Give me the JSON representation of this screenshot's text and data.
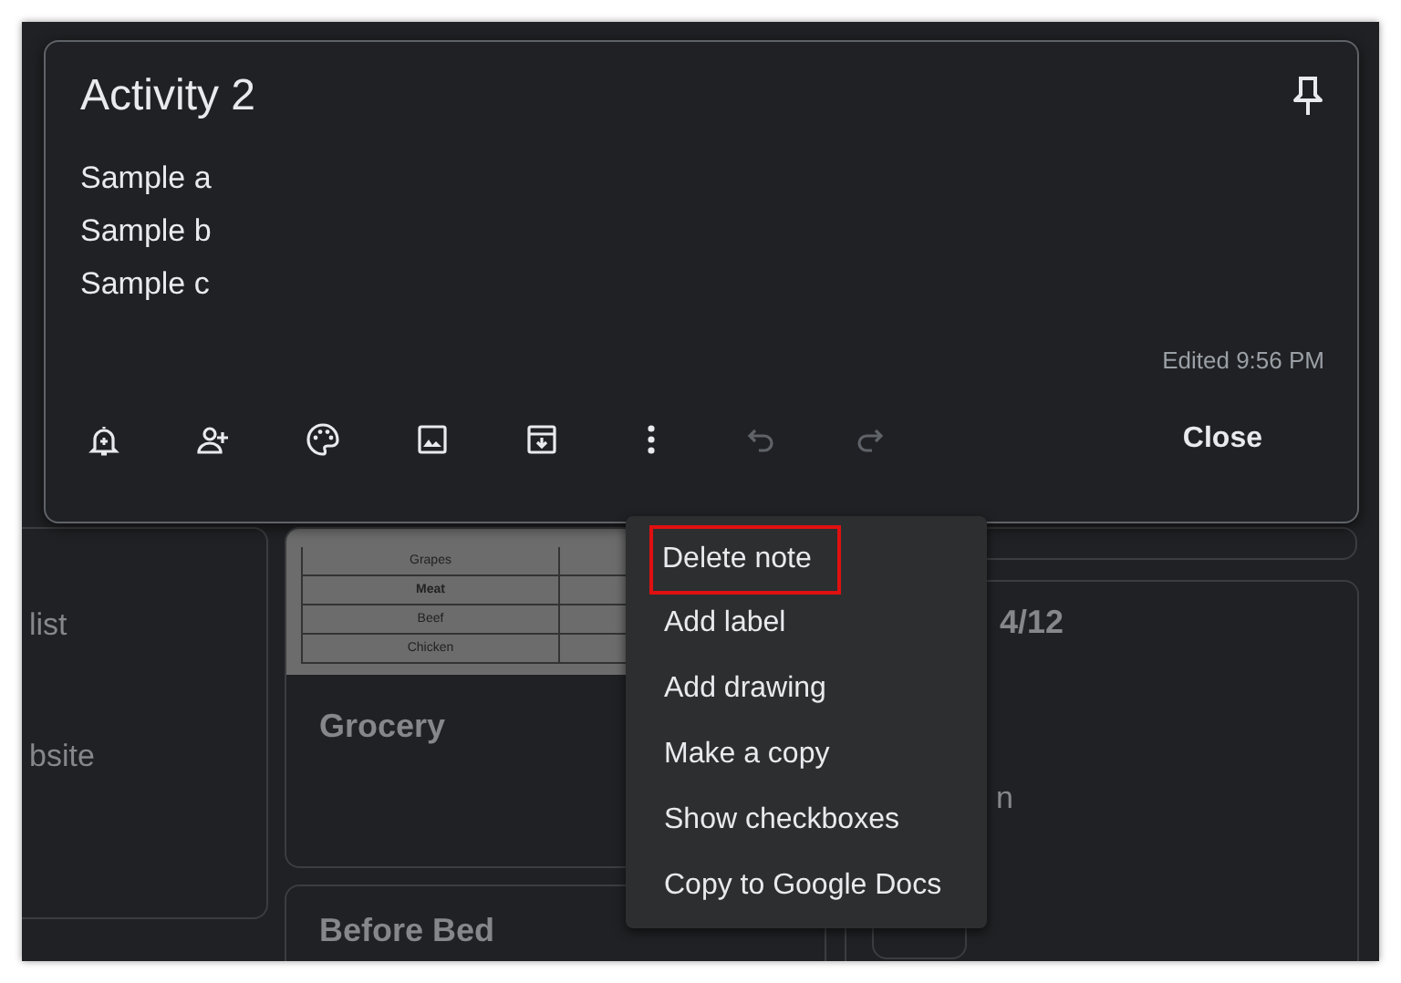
{
  "background": {
    "notes": [
      {
        "kind": "left",
        "texts": [
          "list",
          "bsite"
        ]
      },
      {
        "kind": "table",
        "table": [
          {
            "label": "Grapes",
            "bold": false
          },
          {
            "label": "Meat",
            "bold": true
          },
          {
            "label": "Beef",
            "bold": false
          },
          {
            "label": "Chicken",
            "bold": false
          }
        ],
        "title": "Grocery"
      },
      {
        "kind": "plain",
        "title": "Before Bed"
      },
      {
        "kind": "right",
        "title": "4/12",
        "texts": [
          "n"
        ]
      }
    ]
  },
  "note": {
    "title": "Activity 2",
    "lines": [
      "Sample a",
      "Sample b",
      "Sample c"
    ],
    "edited": "Edited 9:56 PM",
    "toolbar": [
      {
        "kind": "reminder",
        "disabled": false
      },
      {
        "kind": "collaborator",
        "disabled": false
      },
      {
        "kind": "palette",
        "disabled": false
      },
      {
        "kind": "image",
        "disabled": false
      },
      {
        "kind": "archive",
        "disabled": false
      },
      {
        "kind": "more",
        "disabled": false
      },
      {
        "kind": "undo",
        "disabled": true
      },
      {
        "kind": "redo",
        "disabled": true
      }
    ],
    "close": "Close"
  },
  "menu": {
    "items": [
      {
        "label": "Delete note",
        "highlighted": true
      },
      {
        "label": "Add label",
        "highlighted": false
      },
      {
        "label": "Add drawing",
        "highlighted": false
      },
      {
        "label": "Make a copy",
        "highlighted": false
      },
      {
        "label": "Show checkboxes",
        "highlighted": false
      },
      {
        "label": "Copy to Google Docs",
        "highlighted": false
      }
    ]
  }
}
